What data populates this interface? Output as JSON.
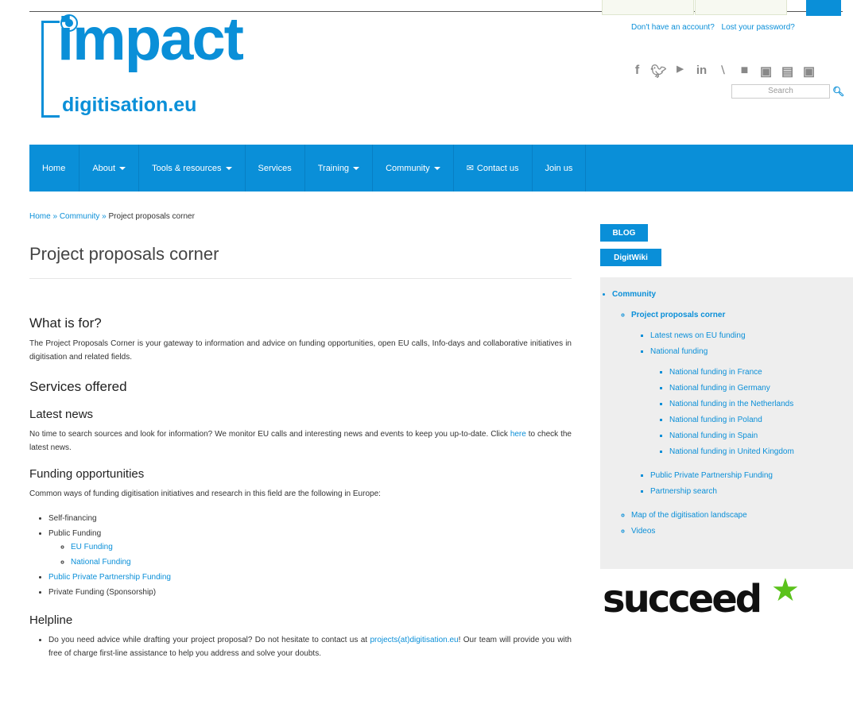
{
  "header": {
    "account_links": [
      "Don't have an account?",
      "Lost your password?"
    ],
    "logo_word": "impact",
    "logo_domain": "digitisation.eu",
    "search_placeholder": "Search",
    "social_icons": [
      "facebook-icon",
      "twitter-icon",
      "youtube-icon",
      "linkedin-icon",
      "rss-icon",
      "flickr-icon",
      "vimeo-icon",
      "slideshare-icon",
      "github-icon"
    ]
  },
  "nav": {
    "items": [
      {
        "label": "Home",
        "dropdown": false
      },
      {
        "label": "About",
        "dropdown": true
      },
      {
        "label": "Tools & resources",
        "dropdown": true
      },
      {
        "label": "Services",
        "dropdown": false
      },
      {
        "label": "Training",
        "dropdown": true
      },
      {
        "label": "Community",
        "dropdown": true
      },
      {
        "label": "Contact us",
        "dropdown": false
      },
      {
        "label": "Join us",
        "dropdown": false
      }
    ]
  },
  "breadcrumb": {
    "items": [
      "Home",
      "Community",
      "Project proposals corner"
    ],
    "sep": "»"
  },
  "page": {
    "title": "Project proposals corner",
    "what_heading": "What is for?",
    "what_text": "The Project Proposals Corner is your gateway to information and advice on funding opportunities, open EU calls, Info-days and collaborative initiatives in digitisation and related fields.",
    "services_heading": "Services offered",
    "news_heading": "Latest news",
    "news_text_1": "No time to search sources and look for information? We monitor EU calls and interesting news and events to keep you up-to-date. Click",
    "news_link": "here",
    "news_text_2": "to check the latest news.",
    "funding_heading": "Funding opportunities",
    "funding_intro": "Common ways of funding digitisation initiatives and research in this field are the following in Europe:",
    "funding_list": {
      "self": "Self-financing",
      "public": "Public Funding",
      "eu": "EU Funding",
      "national": "National Funding",
      "ppp": "Public Private Partnership Funding",
      "private": "Private Funding (Sponsorship)"
    },
    "helpline_heading": "Helpline",
    "helpline_text_1": "Do you need advice while drafting your project proposal? Do not hesitate to contact us at",
    "helpline_email": "projects(at)digitisation.eu",
    "helpline_text_2": "! Our team will provide you with free of charge first-line assistance to help you address and solve your doubts."
  },
  "sidebar": {
    "blog": "BLOG",
    "wiki": "DigitWiki",
    "community": "Community",
    "ppc": "Project proposals corner",
    "latest_eu": "Latest news on EU funding",
    "national": "National funding",
    "national_items": [
      "National funding in France",
      "National funding in Germany",
      "National funding in the Netherlands",
      "National funding in Poland",
      "National funding in Spain",
      "National funding in United Kingdom"
    ],
    "ppp": "Public Private Partnership Funding",
    "partnership": "Partnership search",
    "map": "Map of the digitisation landscape",
    "videos": "Videos",
    "logo_text": "succeed"
  }
}
